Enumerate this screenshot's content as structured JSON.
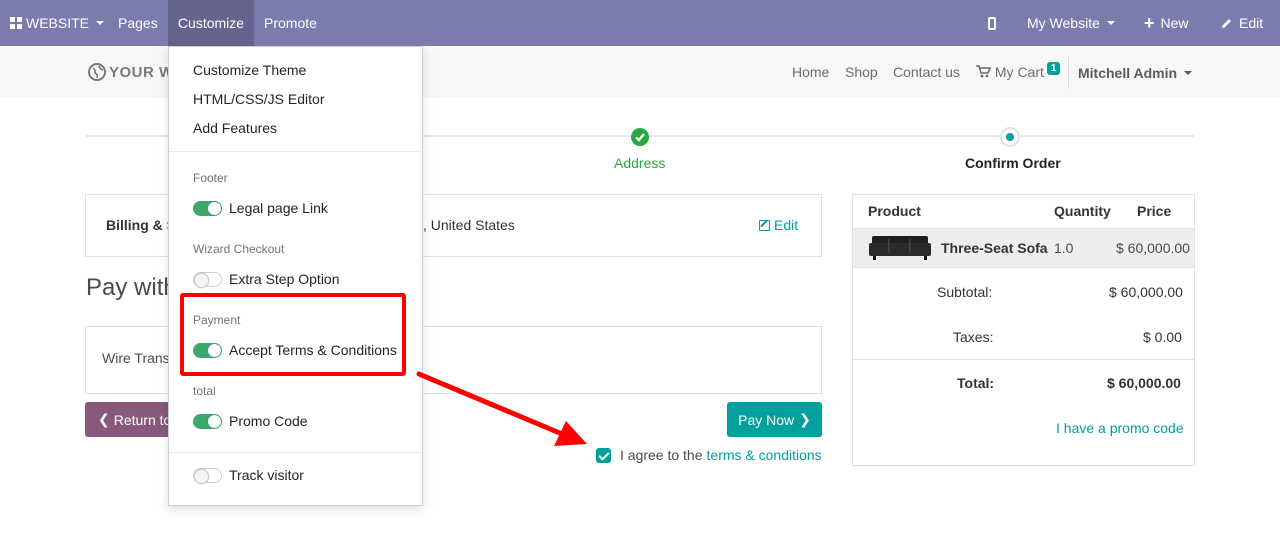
{
  "topbar": {
    "website_label": "WEBSITE",
    "pages_label": "Pages",
    "customize_label": "Customize",
    "promote_label": "Promote",
    "my_website_label": "My Website",
    "new_label": "New",
    "edit_label": "Edit",
    "background_color": "#7c7bad"
  },
  "site": {
    "logo_text": "YOUR W",
    "nav": {
      "home": "Home",
      "shop": "Shop",
      "contact": "Contact us",
      "cart": "My Cart",
      "cart_count": "1",
      "user": "Mitchell Admin"
    }
  },
  "wizard": {
    "steps": [
      {
        "label": "Address",
        "state": "done"
      },
      {
        "label": "Confirm Order",
        "state": "current"
      }
    ]
  },
  "billing": {
    "label": "Billing & S",
    "address": ", United States",
    "edit_label": "Edit"
  },
  "payment": {
    "title": "Pay with",
    "method": "Wire Trans",
    "return_label": "Return to",
    "pay_label": "Pay Now",
    "agree_text": "I agree to the",
    "terms_link": "terms & conditions"
  },
  "summary": {
    "headers": {
      "product": "Product",
      "quantity": "Quantity",
      "price": "Price"
    },
    "items": [
      {
        "name": "Three-Seat Sofa",
        "quantity": "1.0",
        "price": "$ 60,000.00"
      }
    ],
    "subtotal_label": "Subtotal:",
    "subtotal": "$ 60,000.00",
    "taxes_label": "Taxes:",
    "taxes": "$ 0.00",
    "total_label": "Total:",
    "total": "$ 60,000.00",
    "promo_link": "I have a promo code"
  },
  "customize_menu": {
    "items": [
      "Customize Theme",
      "HTML/CSS/JS Editor",
      "Add Features"
    ],
    "sections": [
      {
        "header": "Footer",
        "toggles": [
          {
            "label": "Legal page Link",
            "on": true
          }
        ]
      },
      {
        "header": "Wizard Checkout",
        "toggles": [
          {
            "label": "Extra Step Option",
            "on": false
          }
        ]
      },
      {
        "header": "Payment",
        "toggles": [
          {
            "label": "Accept Terms & Conditions",
            "on": true
          }
        ]
      },
      {
        "header": "total",
        "toggles": [
          {
            "label": "Promo Code",
            "on": true
          }
        ]
      },
      {
        "header": "",
        "toggles": [
          {
            "label": "Track visitor",
            "on": false
          }
        ]
      }
    ]
  },
  "colors": {
    "accent": "#00a09d",
    "primary_purple": "#875a7b",
    "success": "#28a745",
    "annotation_red": "#ff0000"
  }
}
